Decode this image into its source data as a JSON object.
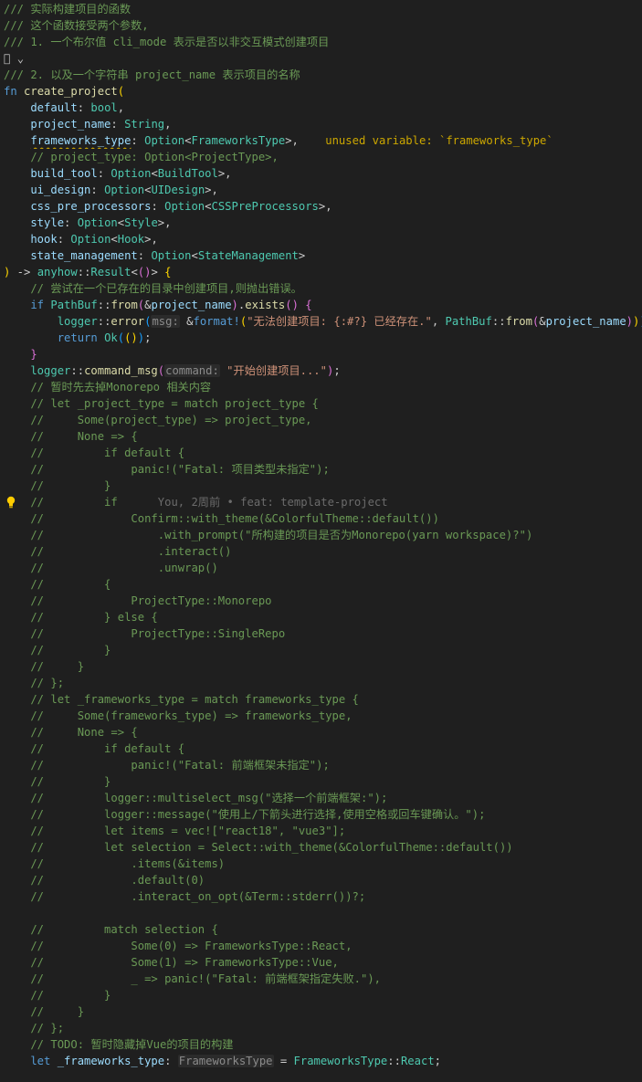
{
  "editor": {
    "language": "rust",
    "colors": {
      "background": "#1f1f1f",
      "comment": "#6a9955",
      "keyword": "#569cd6",
      "function": "#dcdcaa",
      "type": "#4ec9b0",
      "parameter": "#9cdcfe",
      "string": "#ce9178",
      "warning": "#cca700"
    },
    "icons": [
      "lightbulb-icon",
      "fold-chevron-icon"
    ],
    "lines": [
      {
        "tokens": [
          {
            "t": "/// 实际构建项目的函数",
            "c": "comment"
          }
        ]
      },
      {
        "tokens": [
          {
            "t": "/// 这个函数接受两个参数,",
            "c": "comment"
          }
        ]
      },
      {
        "tokens": [
          {
            "t": "/// 1. 一个布尔值 cli_mode 表示是否以非交互模式创建项目",
            "c": "comment"
          }
        ]
      },
      {
        "tokens": [
          {
            "t": " ",
            "c": "fold-toggle"
          },
          {
            "t": "⌄",
            "c": "fold-toggle"
          }
        ]
      },
      {
        "tokens": [
          {
            "t": "/// 2. 以及一个字符串 project_name 表示项目的名称",
            "c": "comment"
          }
        ]
      },
      {
        "tokens": [
          {
            "t": "fn ",
            "c": "keyword"
          },
          {
            "t": "create_project",
            "c": "fn"
          },
          {
            "t": "(",
            "c": "paren1"
          }
        ]
      },
      {
        "tokens": [
          {
            "t": "    default",
            "c": "param"
          },
          {
            "t": ": ",
            "c": "punct"
          },
          {
            "t": "bool",
            "c": "type"
          },
          {
            "t": ",",
            "c": "punct"
          }
        ]
      },
      {
        "tokens": [
          {
            "t": "    project_name",
            "c": "param"
          },
          {
            "t": ": ",
            "c": "punct"
          },
          {
            "t": "String",
            "c": "type"
          },
          {
            "t": ",",
            "c": "punct"
          }
        ]
      },
      {
        "tokens": [
          {
            "t": "    ",
            "c": "punct"
          },
          {
            "t": "frameworks_type",
            "c": "param warnsq"
          },
          {
            "t": ": ",
            "c": "punct"
          },
          {
            "t": "Option",
            "c": "type"
          },
          {
            "t": "<",
            "c": "punct"
          },
          {
            "t": "FrameworksType",
            "c": "type"
          },
          {
            "t": ">,",
            "c": "punct"
          },
          {
            "t": "    unused variable: `frameworks_type`",
            "c": "inline-warning"
          }
        ]
      },
      {
        "tokens": [
          {
            "t": "    // project_type: Option<ProjectType>,",
            "c": "comment"
          }
        ]
      },
      {
        "tokens": [
          {
            "t": "    build_tool",
            "c": "param"
          },
          {
            "t": ": ",
            "c": "punct"
          },
          {
            "t": "Option",
            "c": "type"
          },
          {
            "t": "<",
            "c": "punct"
          },
          {
            "t": "BuildTool",
            "c": "type"
          },
          {
            "t": ">,",
            "c": "punct"
          }
        ]
      },
      {
        "tokens": [
          {
            "t": "    ui_design",
            "c": "param"
          },
          {
            "t": ": ",
            "c": "punct"
          },
          {
            "t": "Option",
            "c": "type"
          },
          {
            "t": "<",
            "c": "punct"
          },
          {
            "t": "UIDesign",
            "c": "type"
          },
          {
            "t": ">,",
            "c": "punct"
          }
        ]
      },
      {
        "tokens": [
          {
            "t": "    css_pre_processors",
            "c": "param"
          },
          {
            "t": ": ",
            "c": "punct"
          },
          {
            "t": "Option",
            "c": "type"
          },
          {
            "t": "<",
            "c": "punct"
          },
          {
            "t": "CSSPreProcessors",
            "c": "type"
          },
          {
            "t": ">,",
            "c": "punct"
          }
        ]
      },
      {
        "tokens": [
          {
            "t": "    style",
            "c": "param"
          },
          {
            "t": ": ",
            "c": "punct"
          },
          {
            "t": "Option",
            "c": "type"
          },
          {
            "t": "<",
            "c": "punct"
          },
          {
            "t": "Style",
            "c": "type"
          },
          {
            "t": ">,",
            "c": "punct"
          }
        ]
      },
      {
        "tokens": [
          {
            "t": "    hook",
            "c": "param"
          },
          {
            "t": ": ",
            "c": "punct"
          },
          {
            "t": "Option",
            "c": "type"
          },
          {
            "t": "<",
            "c": "punct"
          },
          {
            "t": "Hook",
            "c": "type"
          },
          {
            "t": ">,",
            "c": "punct"
          }
        ]
      },
      {
        "tokens": [
          {
            "t": "    state_management",
            "c": "param"
          },
          {
            "t": ": ",
            "c": "punct"
          },
          {
            "t": "Option",
            "c": "type"
          },
          {
            "t": "<",
            "c": "punct"
          },
          {
            "t": "StateManagement",
            "c": "type"
          },
          {
            "t": ">",
            "c": "punct"
          }
        ]
      },
      {
        "tokens": [
          {
            "t": ")",
            "c": "paren1"
          },
          {
            "t": " -> ",
            "c": "punct"
          },
          {
            "t": "anyhow",
            "c": "type"
          },
          {
            "t": "::",
            "c": "punct"
          },
          {
            "t": "Result",
            "c": "type"
          },
          {
            "t": "<",
            "c": "punct"
          },
          {
            "t": "()",
            "c": "paren2"
          },
          {
            "t": "> ",
            "c": "punct"
          },
          {
            "t": "{",
            "c": "paren1"
          }
        ]
      },
      {
        "tokens": [
          {
            "t": "    // 尝试在一个已存在的目录中创建项目,则抛出错误。",
            "c": "comment"
          }
        ]
      },
      {
        "tokens": [
          {
            "t": "    if ",
            "c": "keyword"
          },
          {
            "t": "PathBuf",
            "c": "type"
          },
          {
            "t": "::",
            "c": "punct"
          },
          {
            "t": "from",
            "c": "fn"
          },
          {
            "t": "(",
            "c": "paren2"
          },
          {
            "t": "&",
            "c": "punct"
          },
          {
            "t": "project_name",
            "c": "param"
          },
          {
            "t": ")",
            "c": "paren2"
          },
          {
            "t": ".",
            "c": "punct"
          },
          {
            "t": "exists",
            "c": "fn"
          },
          {
            "t": "()",
            "c": "paren2"
          },
          {
            "t": " ",
            "c": "punct"
          },
          {
            "t": "{",
            "c": "paren2"
          }
        ]
      },
      {
        "tokens": [
          {
            "t": "        logger",
            "c": "type"
          },
          {
            "t": "::",
            "c": "punct"
          },
          {
            "t": "error",
            "c": "fn"
          },
          {
            "t": "(",
            "c": "paren3"
          },
          {
            "t": "msg:",
            "c": "hint"
          },
          {
            "t": " ",
            "c": "punct"
          },
          {
            "t": "&",
            "c": "punct"
          },
          {
            "t": "format!",
            "c": "macro"
          },
          {
            "t": "(",
            "c": "paren1"
          },
          {
            "t": "\"无法创建项目: {:#?} 已经存在.\"",
            "c": "string"
          },
          {
            "t": ", ",
            "c": "punct"
          },
          {
            "t": "PathBuf",
            "c": "type"
          },
          {
            "t": "::",
            "c": "punct"
          },
          {
            "t": "from",
            "c": "fn"
          },
          {
            "t": "(",
            "c": "paren2"
          },
          {
            "t": "&",
            "c": "punct"
          },
          {
            "t": "project_name",
            "c": "param"
          },
          {
            "t": ")",
            "c": "paren2"
          },
          {
            "t": ")",
            "c": "paren1"
          },
          {
            "t": ")",
            "c": "paren3"
          },
          {
            "t": ";",
            "c": "punct"
          }
        ]
      },
      {
        "tokens": [
          {
            "t": "        return ",
            "c": "keyword"
          },
          {
            "t": "Ok",
            "c": "type"
          },
          {
            "t": "(",
            "c": "paren3"
          },
          {
            "t": "()",
            "c": "paren1"
          },
          {
            "t": ")",
            "c": "paren3"
          },
          {
            "t": ";",
            "c": "punct"
          }
        ]
      },
      {
        "tokens": [
          {
            "t": "    }",
            "c": "paren2"
          }
        ]
      },
      {
        "tokens": [
          {
            "t": "    logger",
            "c": "type"
          },
          {
            "t": "::",
            "c": "punct"
          },
          {
            "t": "command_msg",
            "c": "fn"
          },
          {
            "t": "(",
            "c": "paren2"
          },
          {
            "t": "command:",
            "c": "hint"
          },
          {
            "t": " ",
            "c": "punct"
          },
          {
            "t": "\"开始创建项目...\"",
            "c": "string"
          },
          {
            "t": ")",
            "c": "paren2"
          },
          {
            "t": ";",
            "c": "punct"
          }
        ]
      },
      {
        "tokens": [
          {
            "t": "    // 暂时先去掉Monorepo 相关内容",
            "c": "comment"
          }
        ]
      },
      {
        "tokens": [
          {
            "t": "    // let _project_type = match project_type {",
            "c": "comment"
          }
        ]
      },
      {
        "tokens": [
          {
            "t": "    //     Some(project_type) => project_type,",
            "c": "comment"
          }
        ]
      },
      {
        "tokens": [
          {
            "t": "    //     None => {",
            "c": "comment"
          }
        ]
      },
      {
        "tokens": [
          {
            "t": "    //         if default {",
            "c": "comment"
          }
        ]
      },
      {
        "tokens": [
          {
            "t": "    //             panic!(\"Fatal: 项目类型未指定\");",
            "c": "comment"
          }
        ]
      },
      {
        "tokens": [
          {
            "t": "    //         }",
            "c": "comment"
          }
        ]
      },
      {
        "lightbulb": true,
        "tokens": [
          {
            "t": "    //         if",
            "c": "comment"
          },
          {
            "t": "      You, 2周前 • feat: template-project",
            "c": "blame"
          }
        ]
      },
      {
        "tokens": [
          {
            "t": "    //             Confirm::with_theme(&ColorfulTheme::default())",
            "c": "comment"
          }
        ]
      },
      {
        "tokens": [
          {
            "t": "    //                 .with_prompt(\"所构建的项目是否为Monorepo(yarn workspace)?\")",
            "c": "comment"
          }
        ]
      },
      {
        "tokens": [
          {
            "t": "    //                 .interact()",
            "c": "comment"
          }
        ]
      },
      {
        "tokens": [
          {
            "t": "    //                 .unwrap()",
            "c": "comment"
          }
        ]
      },
      {
        "tokens": [
          {
            "t": "    //         {",
            "c": "comment"
          }
        ]
      },
      {
        "tokens": [
          {
            "t": "    //             ProjectType::Monorepo",
            "c": "comment"
          }
        ]
      },
      {
        "tokens": [
          {
            "t": "    //         } else {",
            "c": "comment"
          }
        ]
      },
      {
        "tokens": [
          {
            "t": "    //             ProjectType::SingleRepo",
            "c": "comment"
          }
        ]
      },
      {
        "tokens": [
          {
            "t": "    //         }",
            "c": "comment"
          }
        ]
      },
      {
        "tokens": [
          {
            "t": "    //     }",
            "c": "comment"
          }
        ]
      },
      {
        "tokens": [
          {
            "t": "    // };",
            "c": "comment"
          }
        ]
      },
      {
        "tokens": [
          {
            "t": "    // let _frameworks_type = match frameworks_type {",
            "c": "comment"
          }
        ]
      },
      {
        "tokens": [
          {
            "t": "    //     Some(frameworks_type) => frameworks_type,",
            "c": "comment"
          }
        ]
      },
      {
        "tokens": [
          {
            "t": "    //     None => {",
            "c": "comment"
          }
        ]
      },
      {
        "tokens": [
          {
            "t": "    //         if default {",
            "c": "comment"
          }
        ]
      },
      {
        "tokens": [
          {
            "t": "    //             panic!(\"Fatal: 前端框架未指定\");",
            "c": "comment"
          }
        ]
      },
      {
        "tokens": [
          {
            "t": "    //         }",
            "c": "comment"
          }
        ]
      },
      {
        "tokens": [
          {
            "t": "    //         logger::multiselect_msg(\"选择一个前端框架:\");",
            "c": "comment"
          }
        ]
      },
      {
        "tokens": [
          {
            "t": "    //         logger::message(\"使用上/下箭头进行选择,使用空格或回车键确认。\");",
            "c": "comment"
          }
        ]
      },
      {
        "tokens": [
          {
            "t": "    //         let items = vec![\"react18\", \"vue3\"];",
            "c": "comment"
          }
        ]
      },
      {
        "tokens": [
          {
            "t": "    //         let selection = Select::with_theme(&ColorfulTheme::default())",
            "c": "comment"
          }
        ]
      },
      {
        "tokens": [
          {
            "t": "    //             .items(&items)",
            "c": "comment"
          }
        ]
      },
      {
        "tokens": [
          {
            "t": "    //             .default(0)",
            "c": "comment"
          }
        ]
      },
      {
        "tokens": [
          {
            "t": "    //             .interact_on_opt(&Term::stderr())?;",
            "c": "comment"
          }
        ]
      },
      {
        "tokens": []
      },
      {
        "tokens": [
          {
            "t": "    //         match selection {",
            "c": "comment"
          }
        ]
      },
      {
        "tokens": [
          {
            "t": "    //             Some(0) => FrameworksType::React,",
            "c": "comment"
          }
        ]
      },
      {
        "tokens": [
          {
            "t": "    //             Some(1) => FrameworksType::Vue,",
            "c": "comment"
          }
        ]
      },
      {
        "tokens": [
          {
            "t": "    //             _ => panic!(\"Fatal: 前端框架指定失败.\"),",
            "c": "comment"
          }
        ]
      },
      {
        "tokens": [
          {
            "t": "    //         }",
            "c": "comment"
          }
        ]
      },
      {
        "tokens": [
          {
            "t": "    //     }",
            "c": "comment"
          }
        ]
      },
      {
        "tokens": [
          {
            "t": "    // };",
            "c": "comment"
          }
        ]
      },
      {
        "tokens": [
          {
            "t": "    // TODO: 暂时隐藏掉Vue的项目的构建",
            "c": "comment"
          }
        ]
      },
      {
        "tokens": [
          {
            "t": "    let ",
            "c": "keyword"
          },
          {
            "t": "_frameworks_type",
            "c": "param"
          },
          {
            "t": ": ",
            "c": "punct"
          },
          {
            "t": "FrameworksType",
            "c": "hint"
          },
          {
            "t": " = ",
            "c": "punct"
          },
          {
            "t": "FrameworksType",
            "c": "type"
          },
          {
            "t": "::",
            "c": "punct"
          },
          {
            "t": "React",
            "c": "type"
          },
          {
            "t": ";",
            "c": "punct"
          }
        ]
      }
    ]
  }
}
